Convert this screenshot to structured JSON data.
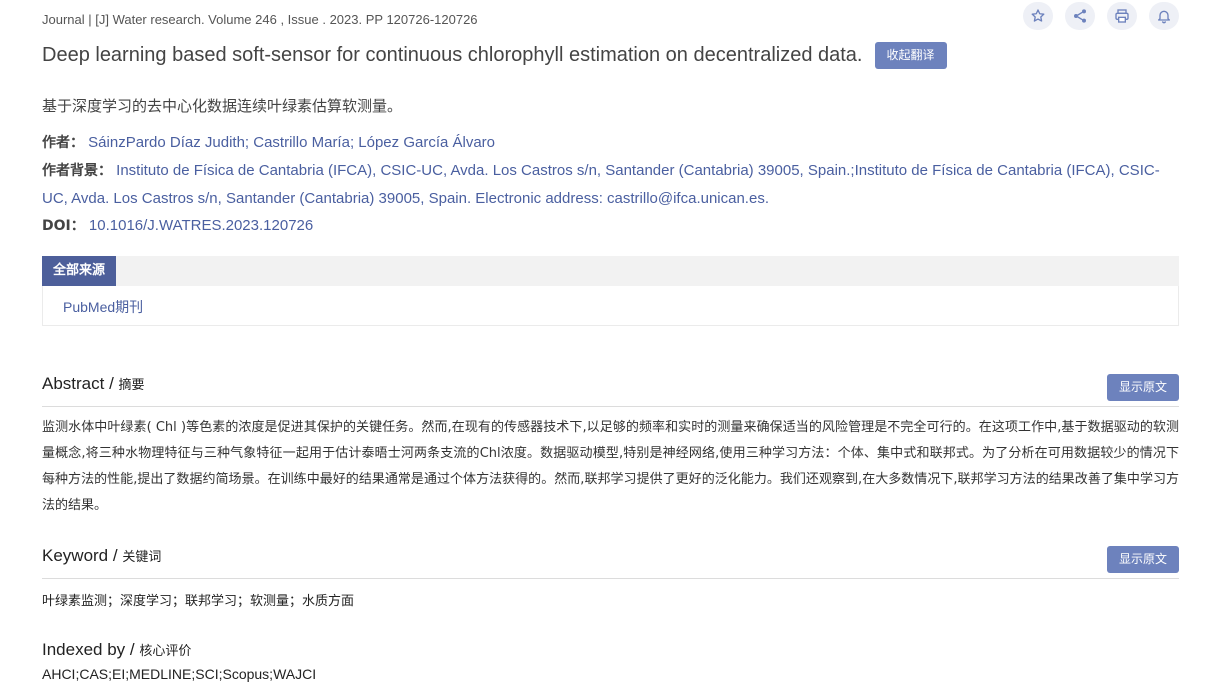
{
  "journal_line": "Journal | [J] Water research. Volume 246 , Issue . 2023. PP 120726-120726",
  "actions": {
    "favorite_icon": "star-icon",
    "share_icon": "share-icon",
    "print_icon": "print-icon",
    "notify_icon": "bell-icon",
    "color": "#6d82bd"
  },
  "title_en": "Deep learning based soft-sensor for continuous chlorophyll estimation on decentralized data.",
  "collapse_translation_label": "收起翻译",
  "title_zh": "基于深度学习的去中心化数据连续叶绿素估算软测量。",
  "authors": {
    "label": "作者：",
    "value": "SáinzPardo Díaz Judith; Castrillo María; López García Álvaro"
  },
  "affiliation": {
    "label": "作者背景：",
    "value": "Instituto de Física de Cantabria (IFCA), CSIC-UC, Avda. Los Castros s/n, Santander (Cantabria) 39005, Spain.;Instituto de Física de Cantabria (IFCA), CSIC-UC, Avda. Los Castros s/n, Santander (Cantabria) 39005, Spain. Electronic address: castrillo@ifca.unican.es."
  },
  "doi": {
    "label": "DOI：",
    "value": "10.1016/J.WATRES.2023.120726"
  },
  "sources": {
    "tab_label": "全部来源",
    "link": "PubMed期刊"
  },
  "abstract": {
    "title_en": "Abstract",
    "title_zh": "摘要",
    "show_original_label": "显示原文",
    "text": "监测水体中叶绿素( Chl )等色素的浓度是促进其保护的关键任务。然而,在现有的传感器技术下,以足够的频率和实时的测量来确保适当的风险管理是不完全可行的。在这项工作中,基于数据驱动的软测量概念,将三种水物理特征与三种气象特征一起用于估计泰晤士河两条支流的Chl浓度。数据驱动模型,特别是神经网络,使用三种学习方法：个体、集中式和联邦式。为了分析在可用数据较少的情况下每种方法的性能,提出了数据约简场景。在训练中最好的结果通常是通过个体方法获得的。然而,联邦学习提供了更好的泛化能力。我们还观察到,在大多数情况下,联邦学习方法的结果改善了集中学习方法的结果。"
  },
  "keyword": {
    "title_en": "Keyword",
    "title_zh": "关键词",
    "show_original_label": "显示原文",
    "text": "叶绿素监测；深度学习；联邦学习；软测量；水质方面"
  },
  "indexed": {
    "title_en": "Indexed by",
    "title_zh": "核心评价",
    "text": "AHCI;CAS;EI;MEDLINE;SCI;Scopus;WAJCI"
  },
  "title_sep": " / "
}
